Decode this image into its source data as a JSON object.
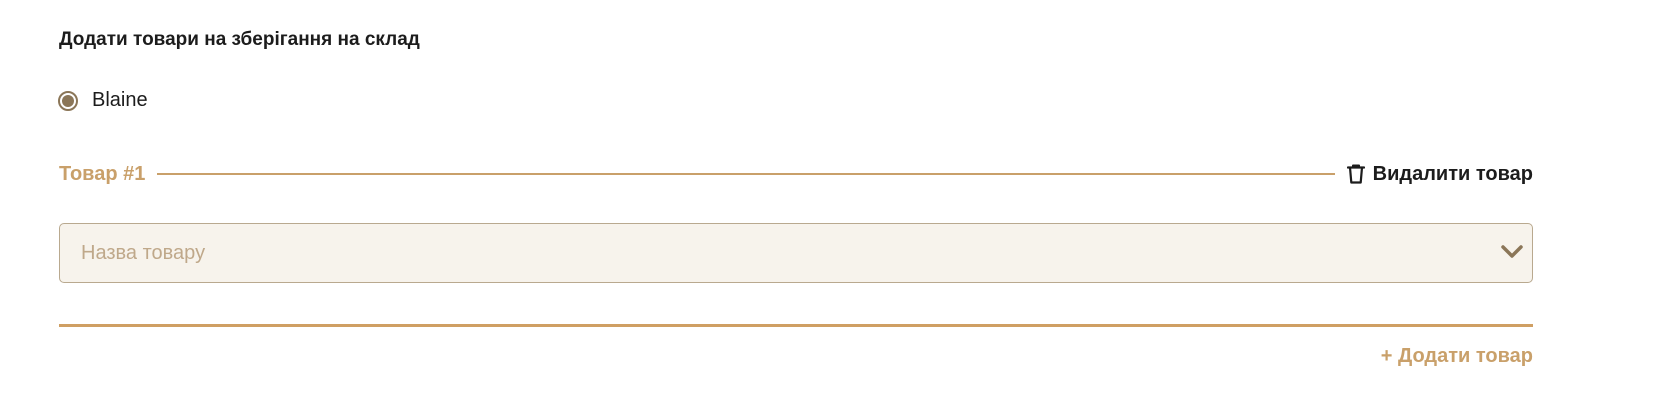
{
  "form": {
    "title": "Додати товари на зберігання на склад",
    "radio": {
      "label": "Blaine",
      "selected": true
    },
    "item": {
      "title": "Товар #1",
      "delete_label": "Видалити товар",
      "delete_icon": "trash-icon",
      "product_select": {
        "placeholder": "Назва товару",
        "value": "",
        "icon": "chevron-down-icon"
      }
    },
    "add_item_label": "+ Додати товар"
  },
  "colors": {
    "accent": "#c9a06a",
    "radio": "#8b7658",
    "select_bg": "#f7f3ec",
    "select_border": "#b9a98f",
    "placeholder": "#bfa88a",
    "text": "#1c1c1c"
  }
}
